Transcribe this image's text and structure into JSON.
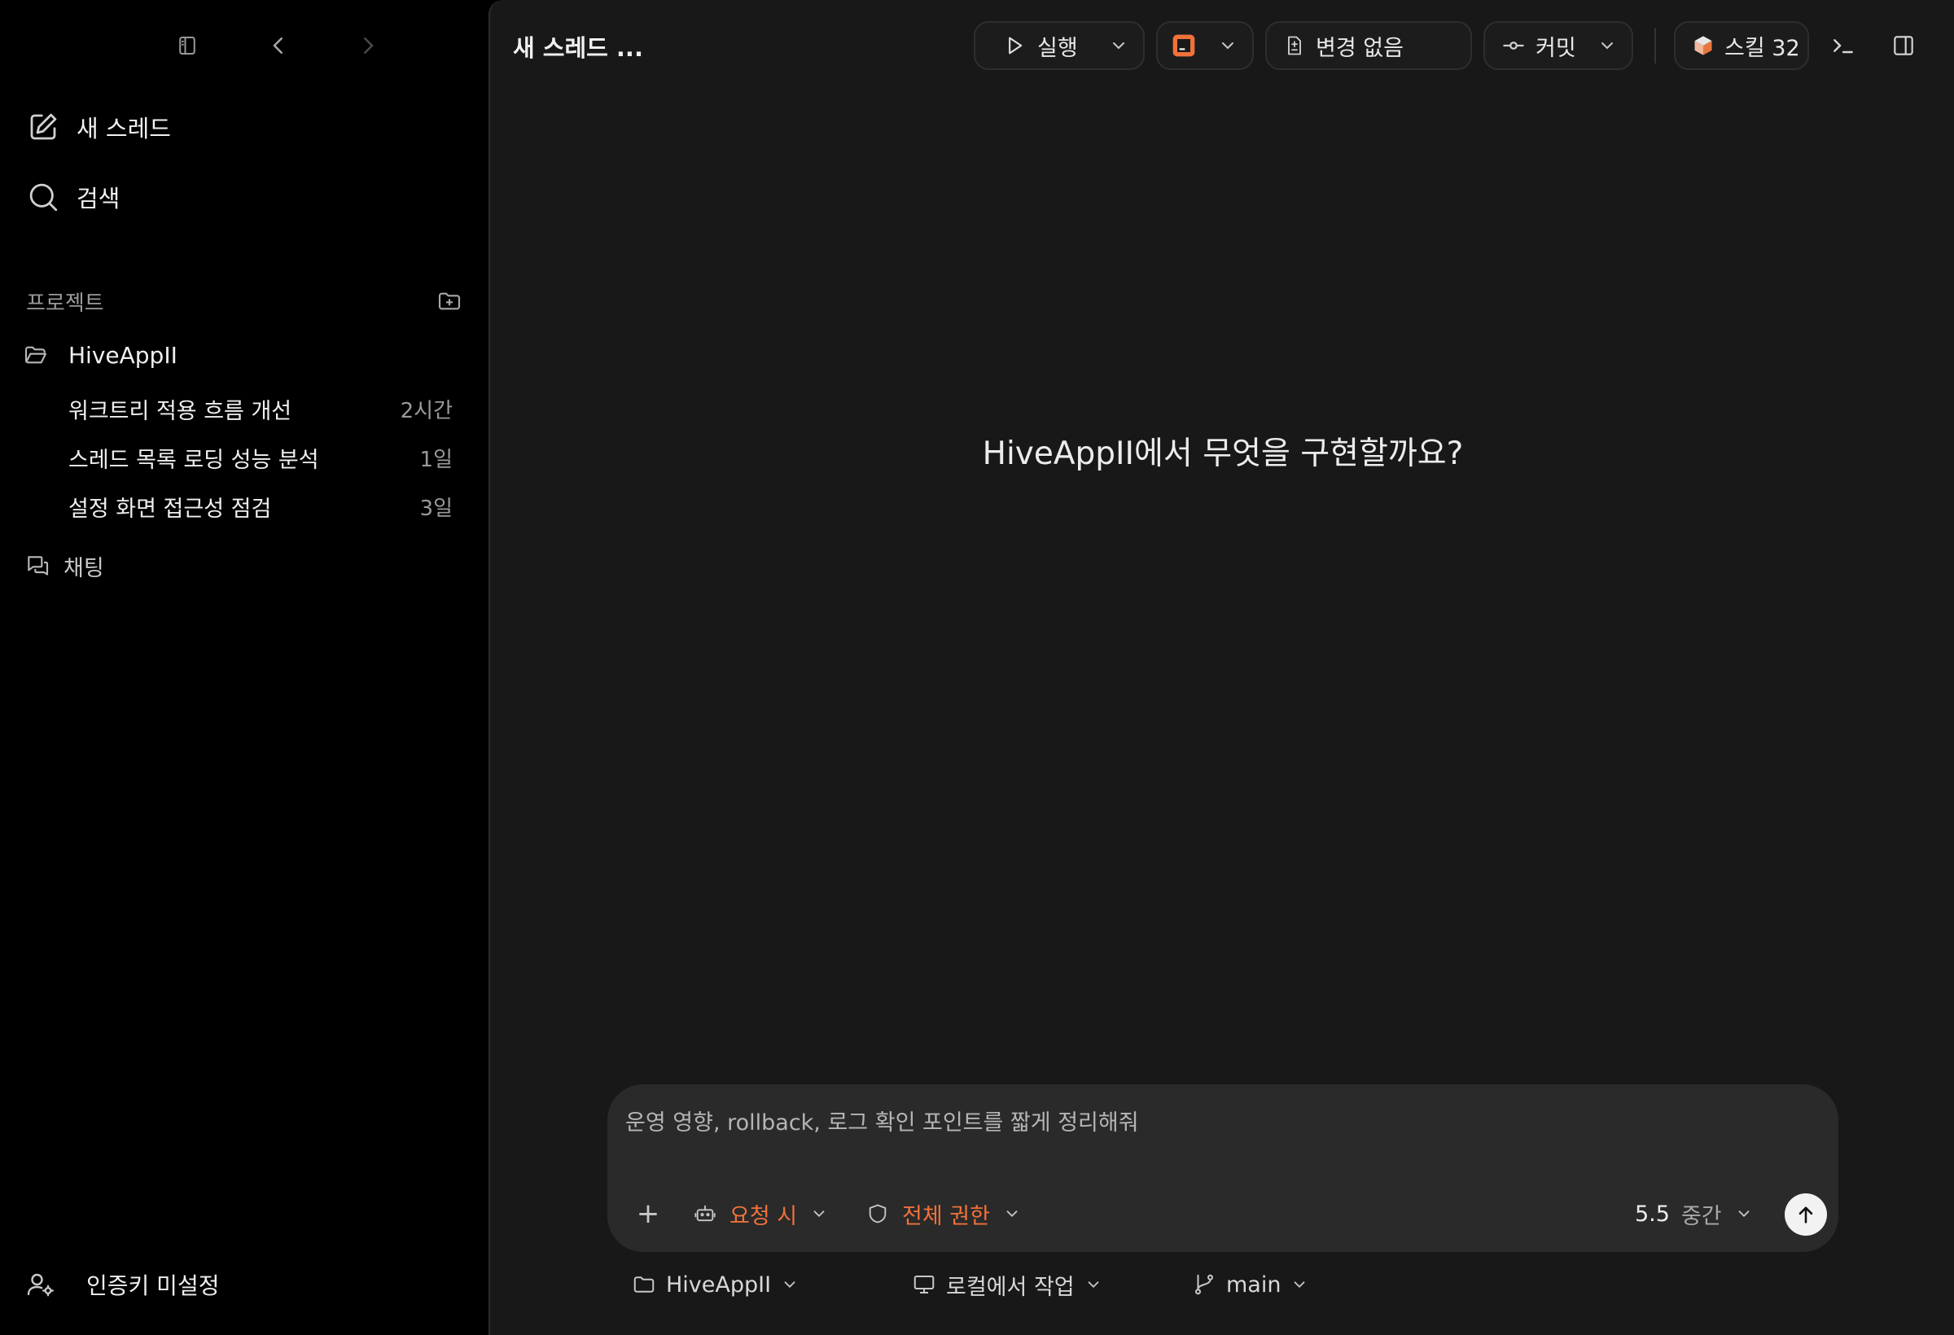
{
  "sidebar": {
    "new_thread_label": "새 스레드",
    "search_label": "검색",
    "projects_heading": "프로젝트",
    "project_name": "HiveAppII",
    "threads": [
      {
        "title": "워크트리 적용 흐름 개선",
        "time": "2시간"
      },
      {
        "title": "스레드 목록 로딩 성능 분석",
        "time": "1일"
      },
      {
        "title": "설정 화면 접근성 점검",
        "time": "3일"
      }
    ],
    "chat_label": "채팅",
    "auth_label": "인증키 미설정"
  },
  "toolbar": {
    "thread_title": "새 스레드 ...",
    "run_label": "실행",
    "changes_label": "변경 없음",
    "commit_label": "커밋",
    "skills_label": "스킬 32"
  },
  "main": {
    "hero_text": "HiveAppII에서 무엇을 구현할까요?"
  },
  "composer": {
    "placeholder": "운영 영향, rollback, 로그 확인 포인트를 짧게 정리해줘",
    "plus_label": "+",
    "approval_label": "요청 시",
    "permission_label": "전체 권한",
    "model_version": "5.5",
    "effort_label": "중간"
  },
  "footer": {
    "project_label": "HiveAppII",
    "environment_label": "로컬에서 작업",
    "branch_label": "main"
  },
  "colors": {
    "accent": "#f0713a",
    "main_bg": "#181818",
    "sidebar_bg": "#000000",
    "composer_bg": "#2a2a2a"
  }
}
